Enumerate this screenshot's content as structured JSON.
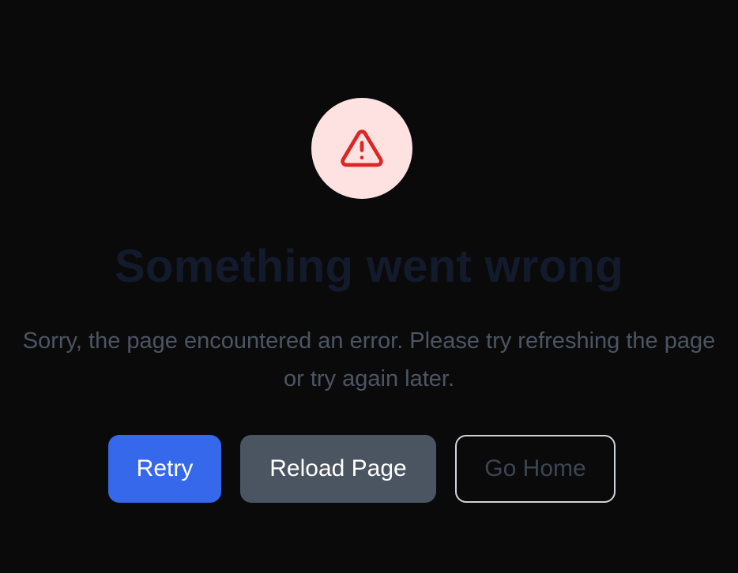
{
  "error": {
    "icon": "warning-triangle-icon",
    "title": "Something went wrong",
    "message": "Sorry, the page encountered an error. Please try refreshing the page or try again later."
  },
  "actions": {
    "retry_label": "Retry",
    "reload_label": "Reload Page",
    "home_label": "Go Home"
  },
  "colors": {
    "background": "#0a0a0b",
    "icon_bg": "#fde2e1",
    "icon_stroke": "#dc2626",
    "primary": "#3568ea",
    "secondary": "#4b5561",
    "outline_border": "#cfd3da"
  }
}
